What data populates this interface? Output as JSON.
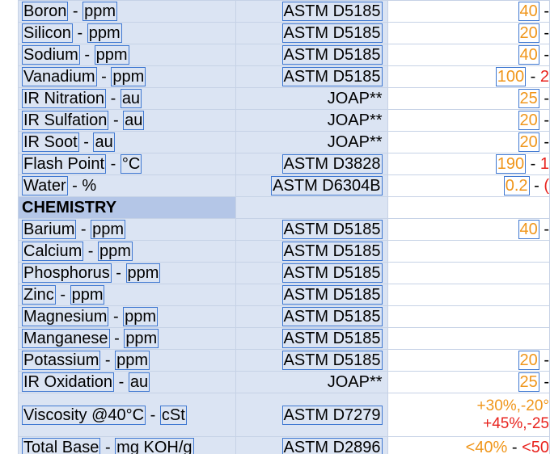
{
  "rows": [
    {
      "name": "Boron",
      "unit": "ppm",
      "method": "ASTM D5185",
      "method_boxed": true,
      "lim_a": "40",
      "lim_b": ""
    },
    {
      "name": "Silicon",
      "unit": "ppm",
      "method": "ASTM D5185",
      "method_boxed": true,
      "lim_a": "20",
      "lim_b": ""
    },
    {
      "name": "Sodium",
      "unit": "ppm",
      "method": "ASTM D5185",
      "method_boxed": true,
      "lim_a": "40",
      "lim_b": ""
    },
    {
      "name": "Vanadium",
      "unit": "ppm",
      "method": "ASTM D5185",
      "method_boxed": true,
      "lim_a": "100",
      "lim_b": "2"
    },
    {
      "name": "IR Nitration",
      "unit": "au",
      "method": "JOAP**",
      "method_boxed": false,
      "lim_a": "25",
      "lim_b": ""
    },
    {
      "name": "IR Sulfation",
      "unit": "au",
      "method": "JOAP**",
      "method_boxed": false,
      "lim_a": "20",
      "lim_b": ""
    },
    {
      "name": "IR Soot",
      "unit": "au",
      "method": "JOAP**",
      "method_boxed": false,
      "lim_a": "20",
      "lim_b": ""
    },
    {
      "name": "Flash Point",
      "unit": "°C",
      "method": "ASTM D3828",
      "method_boxed": true,
      "lim_a": "190",
      "lim_b": "1"
    },
    {
      "name": "Water",
      "unit": "%",
      "unit_plain": true,
      "method": "ASTM D6304B",
      "method_boxed": true,
      "lim_a": "0.2",
      "lim_b": "("
    },
    {
      "section": "CHEMISTRY"
    },
    {
      "name": "Barium",
      "unit": "ppm",
      "method": "ASTM D5185",
      "method_boxed": true,
      "lim_a": "40",
      "lim_b": ""
    },
    {
      "name": "Calcium",
      "unit": "ppm",
      "method": "ASTM D5185",
      "method_boxed": true
    },
    {
      "name": "Phosphorus",
      "unit": "ppm",
      "method": "ASTM D5185",
      "method_boxed": true
    },
    {
      "name": "Zinc",
      "unit": "ppm",
      "method": "ASTM D5185",
      "method_boxed": true
    },
    {
      "name": "Magnesium",
      "unit": "ppm",
      "method": "ASTM D5185",
      "method_boxed": true
    },
    {
      "name": "Manganese",
      "unit": "ppm",
      "method": "ASTM D5185",
      "method_boxed": true
    },
    {
      "name": "Potassium",
      "unit": "ppm",
      "method": "ASTM D5185",
      "method_boxed": true,
      "lim_a": "20",
      "lim_b": ""
    },
    {
      "name": "IR Oxidation",
      "unit": "au",
      "method": "JOAP**",
      "method_boxed": false,
      "lim_a": "25",
      "lim_b": ""
    },
    {
      "name": "Viscosity @40°C",
      "unit": "cSt",
      "method": "ASTM D7279",
      "method_boxed": true,
      "tall": true,
      "lim_line1": "+30%,-20°",
      "lim_line2": "+45%,-25"
    },
    {
      "name": "Total Base",
      "unit": "mg KOH/g",
      "method": "ASTM D2896",
      "method_boxed": true,
      "lim_a": "<40%",
      "lim_b": "<50"
    }
  ],
  "colors": {
    "caution": "#f0961b",
    "critical": "#e8231e",
    "label_bg": "#dbe4f3",
    "section_bg": "#b4c6e7"
  }
}
